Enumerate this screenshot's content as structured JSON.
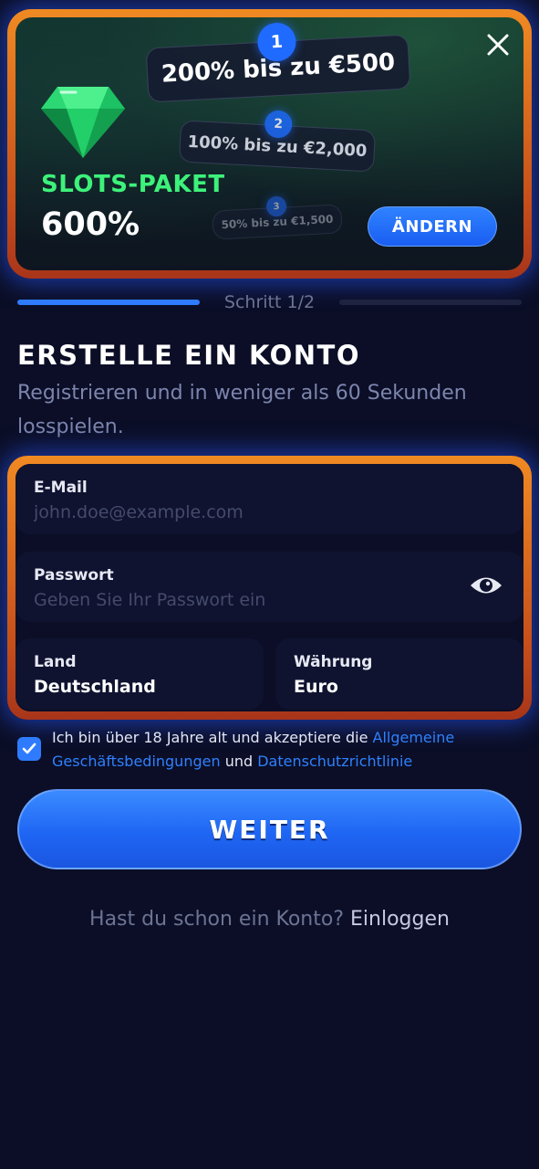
{
  "promo": {
    "tiers": [
      {
        "number": "1",
        "text": "200% bis zu €500"
      },
      {
        "number": "2",
        "text": "100% bis zu €2,000"
      },
      {
        "number": "3",
        "text": "50% bis zu €1,500"
      }
    ],
    "package_label": "SLOTS-PAKET",
    "package_percent": "600%",
    "change_label": "ÄNDERN",
    "close_icon": "close-icon",
    "gem_icon": "emerald-gem-icon",
    "accent_green": "#3df27a",
    "border_orange": "#f08a22"
  },
  "steps": {
    "label": "Schritt 1/2",
    "current": 1,
    "total": 2
  },
  "heading": {
    "title": "ERSTELLE EIN KONTO",
    "subtitle": "Registrieren und in weniger als 60 Sekunden losspielen."
  },
  "form": {
    "email": {
      "label": "E-Mail",
      "placeholder": "john.doe@example.com",
      "value": ""
    },
    "password": {
      "label": "Passwort",
      "placeholder": "Geben Sie Ihr Passwort ein",
      "value": "",
      "toggle_icon": "eye-icon"
    },
    "country": {
      "label": "Land",
      "value": "Deutschland"
    },
    "currency": {
      "label": "Währung",
      "value": "Euro"
    }
  },
  "terms": {
    "checked": true,
    "text_before": "Ich bin über 18 Jahre alt und akzeptiere die ",
    "link_terms": "Allgemeine Geschäftsbedingungen",
    "text_and": " und ",
    "link_privacy": "Datenschutzrichtlinie"
  },
  "continue_label": "WEITER",
  "login": {
    "prompt": "Hast du schon ein Konto? ",
    "link": "Einloggen"
  },
  "colors": {
    "background": "#0b0e26",
    "primary_blue": "#2e7bff",
    "muted_text": "#7c85ad"
  }
}
